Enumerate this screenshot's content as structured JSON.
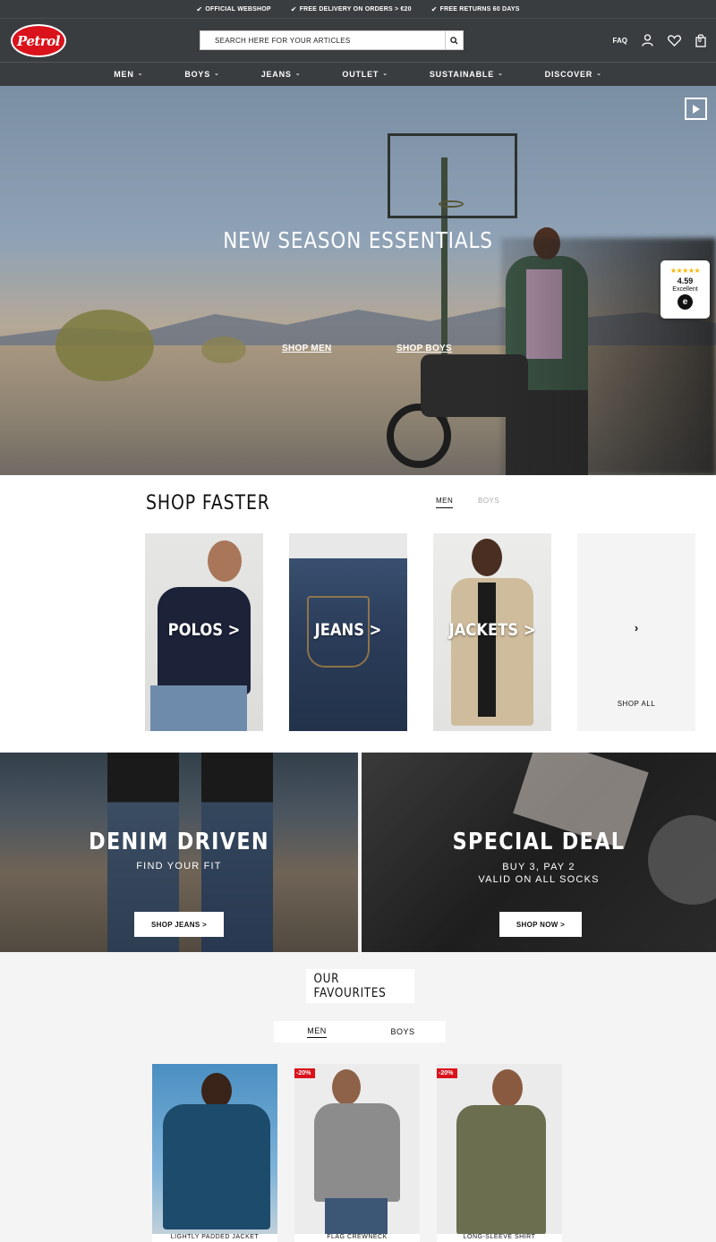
{
  "usp": [
    "OFFICIAL WEBSHOP",
    "FREE DELIVERY ON ORDERS > €20",
    "FREE RETURNS 60 DAYS"
  ],
  "header": {
    "logo_text": "Petrol",
    "search_placeholder": "SEARCH HERE FOR YOUR ARTICLES",
    "faq": "FAQ",
    "cart_count": "0"
  },
  "nav": [
    "MEN",
    "BOYS",
    "JEANS",
    "OUTLET",
    "SUSTAINABLE",
    "DISCOVER"
  ],
  "hero": {
    "title": "NEW SEASON ESSENTIALS",
    "link_men": "SHOP MEN",
    "link_boys": "SHOP BOYS",
    "rating_score": "4.59",
    "rating_label": "Excellent",
    "rating_stars": "★★★★★",
    "rating_mark": "e"
  },
  "shop_faster": {
    "title": "SHOP FASTER",
    "tab_men": "MEN",
    "tab_boys": "BOYS",
    "cards": [
      "POLOS >",
      "JEANS >",
      "JACKETS >"
    ],
    "shop_all_arrow": "›",
    "shop_all": "SHOP ALL"
  },
  "promos": {
    "denim_title": "DENIM DRIVEN",
    "denim_sub": "FIND YOUR FIT",
    "denim_btn": "SHOP JEANS >",
    "deal_title": "SPECIAL DEAL",
    "deal_sub1": "BUY 3, PAY 2",
    "deal_sub2": "VALID ON ALL SOCKS",
    "deal_btn": "SHOP NOW >"
  },
  "favourites": {
    "title": "OUR FAVOURITES",
    "tab_men": "MEN",
    "tab_boys": "BOYS",
    "products": [
      {
        "name": "LIGHTLY PADDED JACKET",
        "badge": ""
      },
      {
        "name": "FLAG CREWNECK",
        "badge": "-20%"
      },
      {
        "name": "LONG-SLEEVE SHIRT",
        "badge": "-20%"
      }
    ]
  },
  "colors": {
    "header": "#3a3d40",
    "brand_red": "#d9121b",
    "accent_star": "#f5b70a"
  }
}
